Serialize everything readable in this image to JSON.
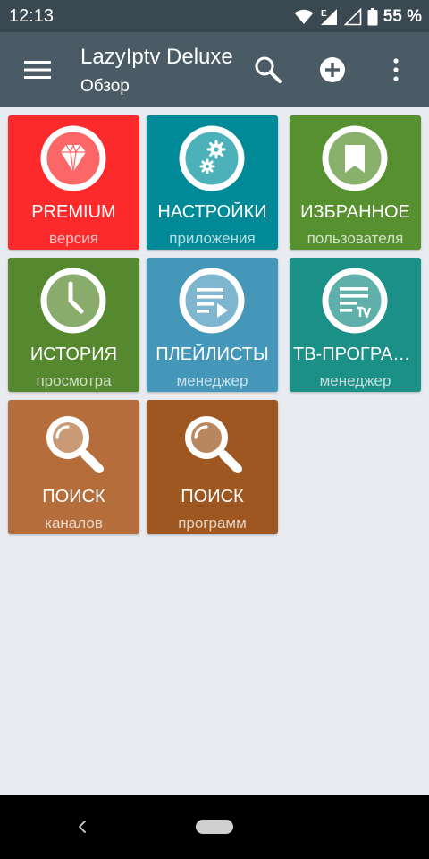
{
  "status_bar": {
    "time": "12:13",
    "network_type": "E",
    "battery": "55 %",
    "icons": [
      "wifi-icon",
      "signal-icon",
      "signal-empty-icon",
      "battery-icon"
    ]
  },
  "app_bar": {
    "title": "LazyIptv Deluxe",
    "subtitle": "Обзор",
    "icons": [
      "menu-icon",
      "search-icon",
      "add-circle-icon",
      "more-vert-icon"
    ]
  },
  "tiles": [
    {
      "label": "PREMIUM",
      "sub": "версия",
      "color": "#fc2a2b",
      "icon": "diamond-icon"
    },
    {
      "label": "НАСТРОЙКИ",
      "sub": "приложения",
      "color": "#008a97",
      "icon": "gears-icon"
    },
    {
      "label": "ИЗБРАННОЕ",
      "sub": "пользователя",
      "color": "#57902f",
      "icon": "bookmark-icon"
    },
    {
      "label": "ИСТОРИЯ",
      "sub": "просмотра",
      "color": "#56892f",
      "icon": "clock-icon"
    },
    {
      "label": "ПЛЕЙЛИСТЫ",
      "sub": "менеджер",
      "color": "#4597b9",
      "icon": "playlist-play-icon"
    },
    {
      "label": "ТВ-ПРОГРАММА",
      "sub": "менеджер",
      "color": "#1b9087",
      "icon": "tv-guide-icon"
    },
    {
      "label": "ПОИСК",
      "sub": "каналов",
      "color": "#b56e3b",
      "icon": "search-icon"
    },
    {
      "label": "ПОИСК",
      "sub": "программ",
      "color": "#9e5721",
      "icon": "search-icon"
    }
  ],
  "nav_bar": {
    "icons": [
      "back-icon",
      "home-pill-icon"
    ]
  }
}
